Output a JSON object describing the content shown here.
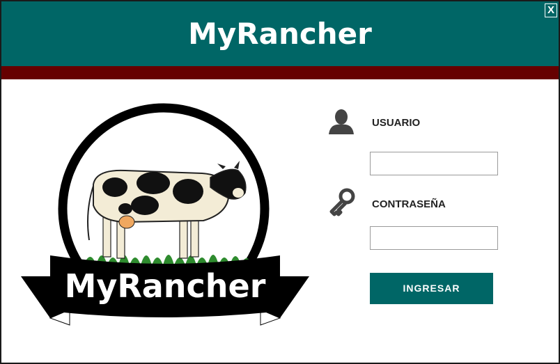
{
  "header": {
    "title": "MyRancher",
    "close_label": "X",
    "bg_color": "#006666",
    "stripe_color": "#660000"
  },
  "logo": {
    "text": "MyRancher",
    "icon": "cow-logo"
  },
  "form": {
    "username_label": "USUARIO",
    "username_icon": "user-icon",
    "username_value": "",
    "password_label": "CONTRASEÑA",
    "password_icon": "key-icon",
    "password_value": "",
    "submit_label": "INGRESAR",
    "accent_color": "#006666"
  }
}
